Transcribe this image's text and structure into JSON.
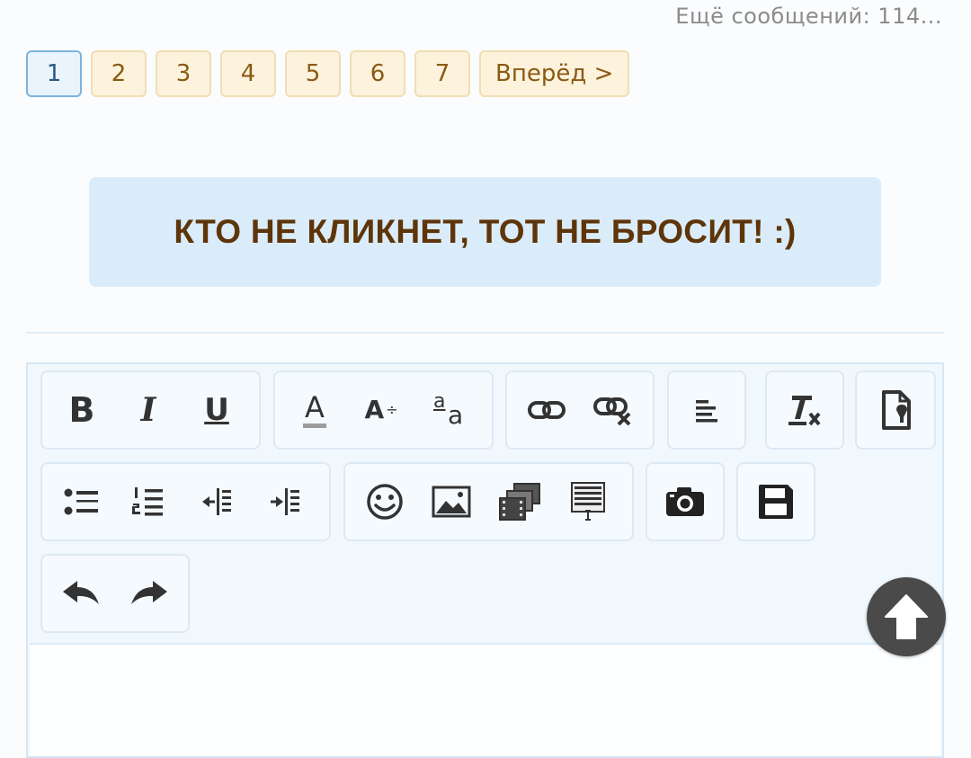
{
  "header": {
    "more_messages": "Ещё сообщений: 114..."
  },
  "pagination": {
    "current": "1",
    "pages": [
      "2",
      "3",
      "4",
      "5",
      "6",
      "7"
    ],
    "next_label": "Вперёд >"
  },
  "banner": {
    "text": "КТО НЕ КЛИКНЕТ, ТОТ НЕ БРОСИТ! :)"
  },
  "toolbar": {
    "bold": "B",
    "italic": "I",
    "underline": "U",
    "font_color": "A",
    "font_size_letter": "A",
    "font_size_arrows": "÷",
    "special_top": "a",
    "special_bottom": "a"
  },
  "colors": {
    "link": "#8a5a14",
    "banner_bg": "#daecfa",
    "banner_text": "#5e3509",
    "icon": "#333333"
  }
}
